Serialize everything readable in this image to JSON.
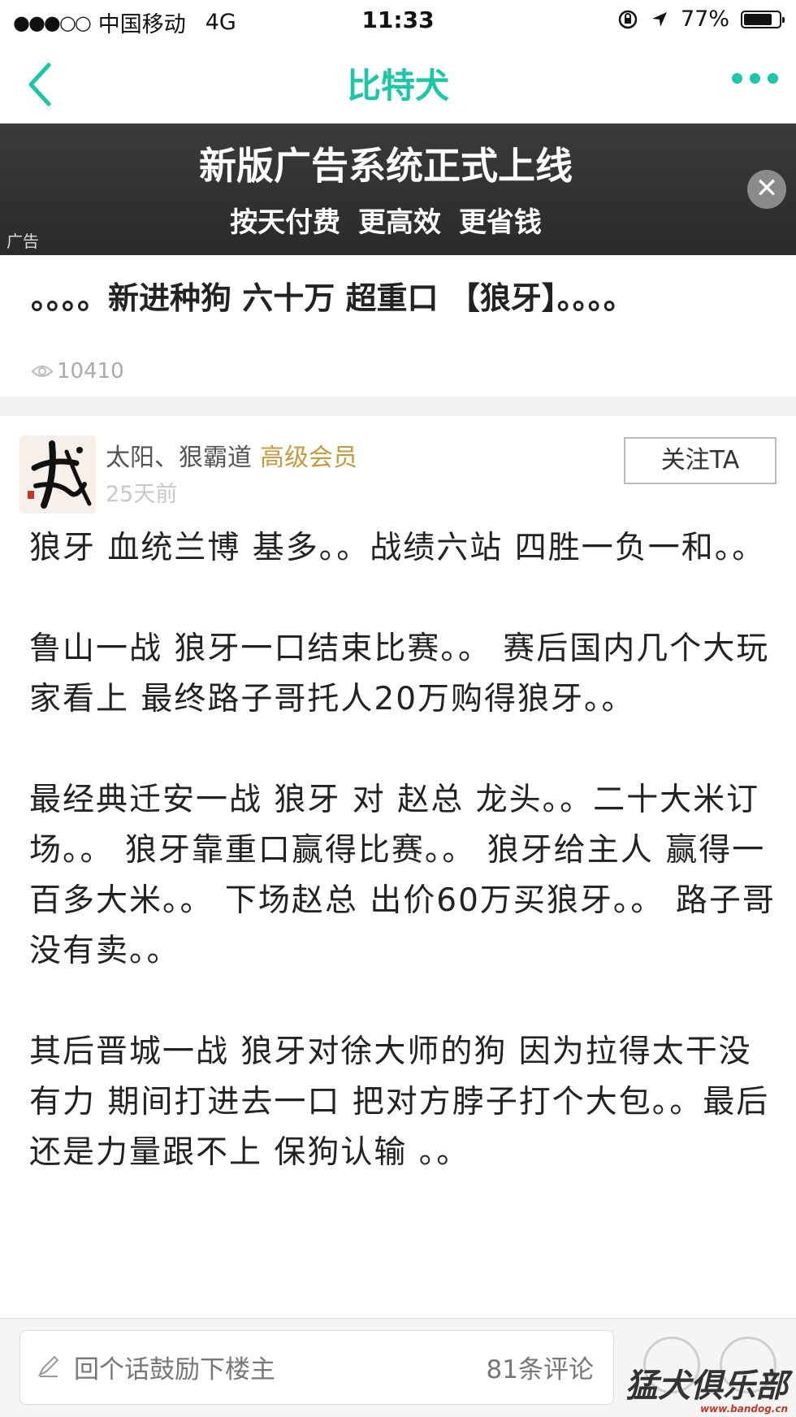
{
  "status_bar": {
    "signal": "●●●○○",
    "carrier": "中国移动",
    "network": "4G",
    "time": "11:33",
    "battery": "77%",
    "battery_level": 0.77
  },
  "nav": {
    "title": "比特犬"
  },
  "ad": {
    "headline": "新版广告系统正式上线",
    "subline": "按天付费 更高效  更省钱",
    "tag": "广告",
    "close_symbol": "✕"
  },
  "post": {
    "title": "。。。。新进种狗 六十万 超重口 【狼牙】。。。。",
    "views": "10410"
  },
  "author": {
    "name": "太阳、狠霸道",
    "badge": "高级会员",
    "time": "25天前",
    "follow_label": "关注TA"
  },
  "content": {
    "paragraphs": [
      "狼牙 血统兰博 基多。。战绩六站 四胜一负一和。。",
      "鲁山一战 狼牙一口结束比赛。。 赛后国内几个大玩家看上 最终路子哥托人20万购得狼牙。。",
      "最经典迁安一战 狼牙 对 赵总 龙头。。二十大米订场。。 狼牙靠重口赢得比赛。。 狼牙给主人 赢得一百多大米。。 下场赵总 出价60万买狼牙。。 路子哥没有卖。。",
      "其后晋城一战 狼牙对徐大师的狗 因为拉得太干没有力 期间打进去一口 把对方脖子打个大包。。最后还是力量跟不上 保狗认输 。。"
    ]
  },
  "bottom_bar": {
    "comment_placeholder": "回个话鼓励下楼主",
    "comment_count": "81条评论",
    "watermark": "猛犬俱乐部",
    "watermark_url": "www.bandog.cn"
  },
  "colors": {
    "accent": "#1cc7a8",
    "member": "#c89a3c",
    "ad_bg": "#333333"
  }
}
